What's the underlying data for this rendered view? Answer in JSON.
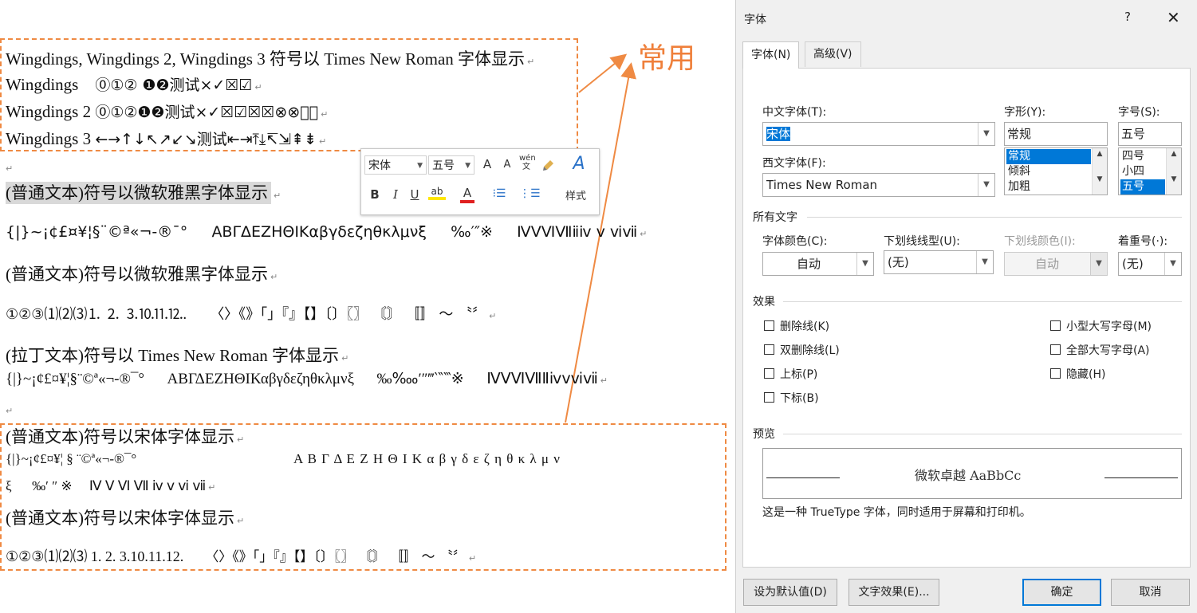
{
  "callout": "常用",
  "doc": {
    "lines": [
      "Wingdings, Wingdings 2, Wingdings 3 符号以 Times New Roman 字体显示",
      "Wingdings",
      "⓪①② ❶❷测试×✓☒☑",
      "Wingdings 2",
      "⓪①②❶❷测试×✓☒☑☒☒⊗⊗⃠⃠",
      "Wingdings 3",
      "←→↑↓↖↗↙↘测试⇤⇥⤒⤓↸⇲⇞⇟",
      "(普通文本)符号以微软雅黑字体显示",
      "{|}~¡¢£¤¥¦§¨©ª«¬-®¯°",
      "ΑΒΓΔΕΖΗΘΙΚαβγδεζηθκλμνξ",
      "‰′″※",
      "ⅣⅤⅥⅦⅱⅳ ⅴ ⅵⅶ",
      "(普通文本)符号以微软雅黑字体显示",
      "①②③⑴⑵⑶⒈ ⒉ ⒊⒑⒒⒓.",
      "〈〉《》「」『』【】〔〕〖〗 〘〙 〚〛 〜 〝〞",
      "(拉丁文本)符号以 Times New Roman 字体显示",
      "{|}~¡¢£¤¥¦§¨©ª«¬-®¯°",
      "ΑΒΓΔΕΖΗΘΙΚαβγδεζηθκλμνξ",
      "‰‱′″‴‵‶‷※",
      "ⅣⅤⅥⅦⅡⅳⅴⅵⅶ",
      "(普通文本)符号以宋体字体显示",
      "{|}~¡¢£¤¥¦ § ¨©ª«¬-®¯°",
      "Α Β Γ Δ Ε Ζ Η Θ Ι Κ α β γ δ ε ζ η θ κ λ μ ν",
      "ξ",
      "‰′ ″ ※",
      "Ⅳ Ⅴ Ⅵ Ⅶ ⅳ ⅴ ⅵ ⅶ",
      "(普通文本)符号以宋体字体显示",
      "①②③⑴⑵⑶ 1. 2. 3.10.11.12.",
      "〈〉《》「」『』【】〔〕〖〗 〘〙 〚〛 〜 〝〞"
    ]
  },
  "mini_toolbar": {
    "font": "宋体",
    "size": "五号",
    "grow": "A",
    "shrink": "A",
    "phonetic": "wén 文",
    "bold": "B",
    "italic": "I",
    "underline": "U",
    "highlight": "ab",
    "color": "A",
    "styles_label": "样式"
  },
  "dialog": {
    "title": "字体",
    "help": "?",
    "close": "✕",
    "tabs": [
      "字体(N)",
      "高级(V)"
    ],
    "cn_font_label": "中文字体(T):",
    "cn_font_value": "宋体",
    "style_label": "字形(Y):",
    "style_value": "常规",
    "style_options": [
      "常规",
      "倾斜",
      "加粗"
    ],
    "size_label": "字号(S):",
    "size_value": "五号",
    "size_options": [
      "四号",
      "小四",
      "五号"
    ],
    "west_font_label": "西文字体(F):",
    "west_font_value": "Times New Roman",
    "all_text": "所有文字",
    "color_label": "字体颜色(C):",
    "color_value": "自动",
    "underline_label": "下划线线型(U):",
    "underline_value": "(无)",
    "ucolor_label": "下划线颜色(I):",
    "ucolor_value": "自动",
    "emph_label": "着重号(·):",
    "emph_value": "(无)",
    "effects": "效果",
    "effects_left": [
      "删除线(K)",
      "双删除线(L)",
      "上标(P)",
      "下标(B)"
    ],
    "effects_right": [
      "小型大写字母(M)",
      "全部大写字母(A)",
      "隐藏(H)"
    ],
    "preview": "预览",
    "preview_text": "微软卓越 AaBbCc",
    "truetype_note": "这是一种 TrueType 字体，同时适用于屏幕和打印机。",
    "btn_default": "设为默认值(D)",
    "btn_effects": "文字效果(E)...",
    "btn_ok": "确定",
    "btn_cancel": "取消"
  },
  "colors": {
    "accent": "#ef8a43",
    "selection": "#0078d7"
  }
}
